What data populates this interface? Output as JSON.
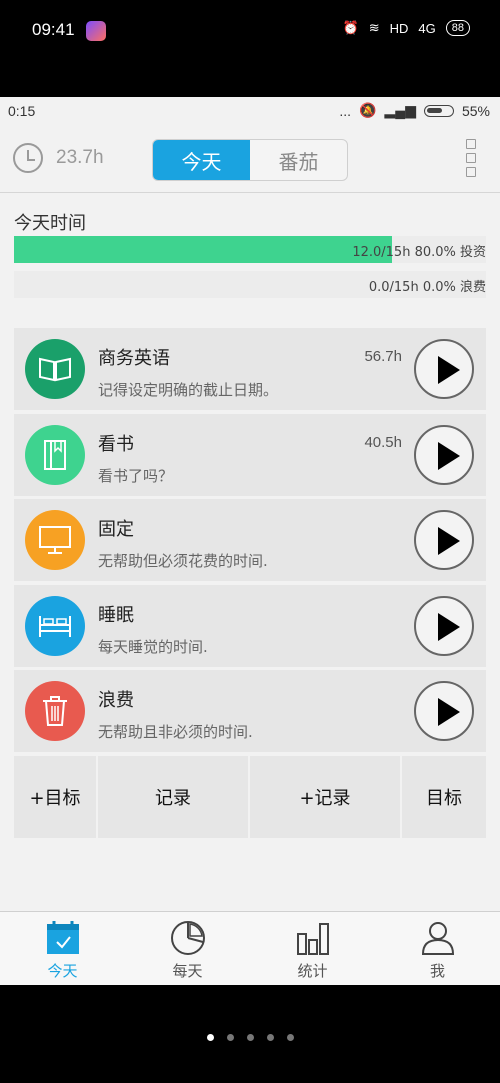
{
  "outer_status": {
    "time": "09:41",
    "network": "HD",
    "signal": "4G",
    "battery": "88"
  },
  "inner_status": {
    "time": "0:15",
    "dots": "...",
    "battery": "55%"
  },
  "header": {
    "total_hours": "23.7h",
    "tabs": [
      "今天",
      "番茄"
    ],
    "active_tab": 0
  },
  "today": {
    "label": "今天时间",
    "invest": {
      "text": "12.0/15h 80.0% 投资",
      "progress": 0.8,
      "color": "#3ed38f"
    },
    "waste": {
      "text": "0.0/15h 0.0% 浪费",
      "progress": 0.0,
      "color": "#e85a4f"
    }
  },
  "items": [
    {
      "title": "商务英语",
      "subtitle": "记得设定明确的截止日期。",
      "hours": "56.7h",
      "color": "#1aa06a",
      "icon": "book-icon"
    },
    {
      "title": "看书",
      "subtitle": "看书了吗？",
      "hours": "40.5h",
      "color": "#3ed38f",
      "icon": "notebook-icon"
    },
    {
      "title": "固定",
      "subtitle": "无帮助但必须花费的时间.",
      "hours": "",
      "color": "#f7a123",
      "icon": "monitor-icon"
    },
    {
      "title": "睡眠",
      "subtitle": "每天睡觉的时间.",
      "hours": "",
      "color": "#1aa3e0",
      "icon": "bed-icon"
    },
    {
      "title": "浪费",
      "subtitle": "无帮助且非必须的时间.",
      "hours": "",
      "color": "#e85a4f",
      "icon": "trash-icon"
    }
  ],
  "actions": [
    "+目标",
    "记录",
    "+记录",
    "目标"
  ],
  "tabbar": [
    {
      "label": "今天",
      "icon": "calendar-icon",
      "active": true
    },
    {
      "label": "每天",
      "icon": "pie-chart-icon",
      "active": false
    },
    {
      "label": "统计",
      "icon": "bar-chart-icon",
      "active": false
    },
    {
      "label": "我",
      "icon": "person-icon",
      "active": false
    }
  ],
  "colors": {
    "accent": "#1aa3e0",
    "invest": "#3ed38f",
    "waste": "#e85a4f"
  }
}
